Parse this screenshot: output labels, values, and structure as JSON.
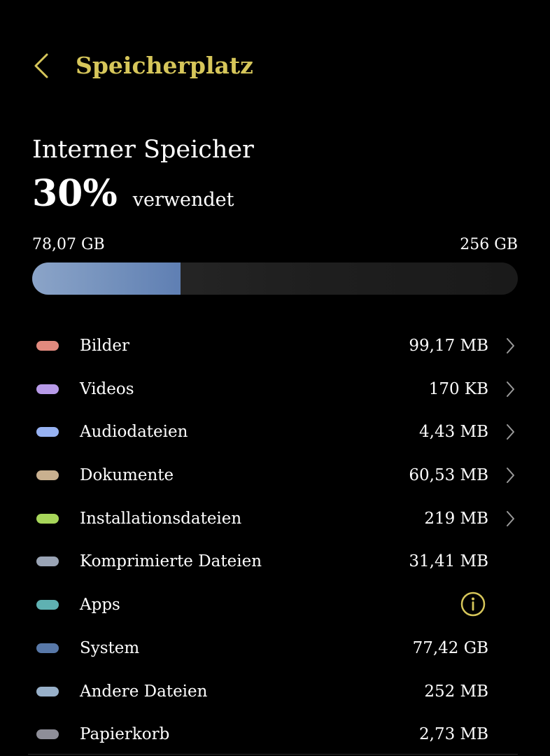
{
  "theme": {
    "accent_color": "#d6c65a",
    "background_color": "#000000",
    "text_color": "#ffffff"
  },
  "header": {
    "back_icon": "chevron-left-icon",
    "title": "Speicherplatz"
  },
  "storage": {
    "title": "Interner Speicher",
    "percent_used": "30%",
    "used_label": "verwendet",
    "used_amount": "78,07 GB",
    "total_amount": "256 GB",
    "fill_fraction": 0.305
  },
  "categories": [
    {
      "label": "Bilder",
      "size": "99,17 MB",
      "color": "#e28a7e",
      "action_icon": "chevron-right-icon"
    },
    {
      "label": "Videos",
      "size": "170 KB",
      "color": "#b79ae8",
      "action_icon": "chevron-right-icon"
    },
    {
      "label": "Audiodateien",
      "size": "4,43 MB",
      "color": "#97b2f2",
      "action_icon": "chevron-right-icon"
    },
    {
      "label": "Dokumente",
      "size": "60,53 MB",
      "color": "#c9b08f",
      "action_icon": "chevron-right-icon"
    },
    {
      "label": "Installationsdateien",
      "size": "219 MB",
      "color": "#a7d65a",
      "action_icon": "chevron-right-icon"
    },
    {
      "label": "Komprimierte Dateien",
      "size": "31,41 MB",
      "color": "#9aa4b5",
      "action_icon": ""
    },
    {
      "label": "Apps",
      "size": "",
      "color": "#5fb1b2",
      "action_icon": "info-icon"
    },
    {
      "label": "System",
      "size": "77,42 GB",
      "color": "#5878a8",
      "action_icon": ""
    },
    {
      "label": "Andere Dateien",
      "size": "252 MB",
      "color": "#98b0c9",
      "action_icon": ""
    },
    {
      "label": "Papierkorb",
      "size": "2,73 MB",
      "color": "#8e8e98",
      "action_icon": ""
    }
  ]
}
